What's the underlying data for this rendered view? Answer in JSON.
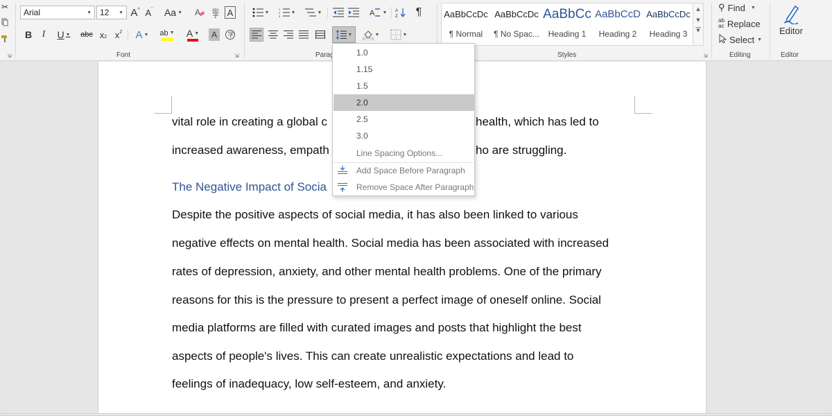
{
  "ribbon": {
    "font": {
      "group_label": "Font",
      "font_name": "Arial",
      "font_size": "12",
      "buttons": {
        "grow": "A",
        "shrink": "A",
        "change_case": "Aa",
        "bold": "B",
        "italic": "I",
        "underline": "U",
        "strikethrough": "abc",
        "subscript": "x",
        "superscript": "x",
        "text_effects": "A",
        "highlight": "ab",
        "font_color": "A",
        "char_shading": "A"
      }
    },
    "paragraph": {
      "group_label": "Paragraph"
    },
    "styles": {
      "group_label": "Styles",
      "items": [
        {
          "sample": "AaBbCcDc",
          "name": "¶ Normal"
        },
        {
          "sample": "AaBbCcDc",
          "name": "¶ No Spac..."
        },
        {
          "sample": "AaBbCc",
          "name": "Heading 1"
        },
        {
          "sample": "AaBbCcD",
          "name": "Heading 2"
        },
        {
          "sample": "AaBbCcDc",
          "name": "Heading 3"
        }
      ]
    },
    "editing": {
      "group_label": "Editing",
      "find": "Find",
      "replace": "Replace",
      "select": "Select"
    },
    "editor": {
      "group_label": "Editor",
      "label": "Editor"
    }
  },
  "line_spacing_menu": {
    "options": [
      "1.0",
      "1.15",
      "1.5",
      "2.0",
      "2.5",
      "3.0"
    ],
    "selected": "2.0",
    "more_options": "Line Spacing Options...",
    "add_space_before": "Add Space Before Paragraph",
    "remove_space_after": "Remove Space After Paragraph"
  },
  "document": {
    "lines": [
      {
        "left": "vital role in creating a global c",
        "right": "health, which has led to"
      },
      {
        "left": "increased awareness, empath",
        "right": "ho are struggling."
      }
    ],
    "heading": "The Negative Impact of Socia",
    "body": [
      "Despite the positive aspects of social media, it has also been linked to various",
      "negative effects on mental health. Social media has been associated with increased",
      "rates of depression, anxiety, and other mental health problems. One of the primary",
      "reasons for this is the pressure to present a perfect image of oneself online. Social",
      "media platforms are filled with curated images and posts that highlight the best",
      "aspects of people's lives. This can create unrealistic expectations and lead to",
      "feelings of inadequacy, low self-esteem, and anxiety."
    ]
  },
  "colors": {
    "highlight": "#ffff00",
    "font_color": "#ff0000",
    "heading": "#2f5496",
    "selected_item": "#c9c9c9"
  }
}
